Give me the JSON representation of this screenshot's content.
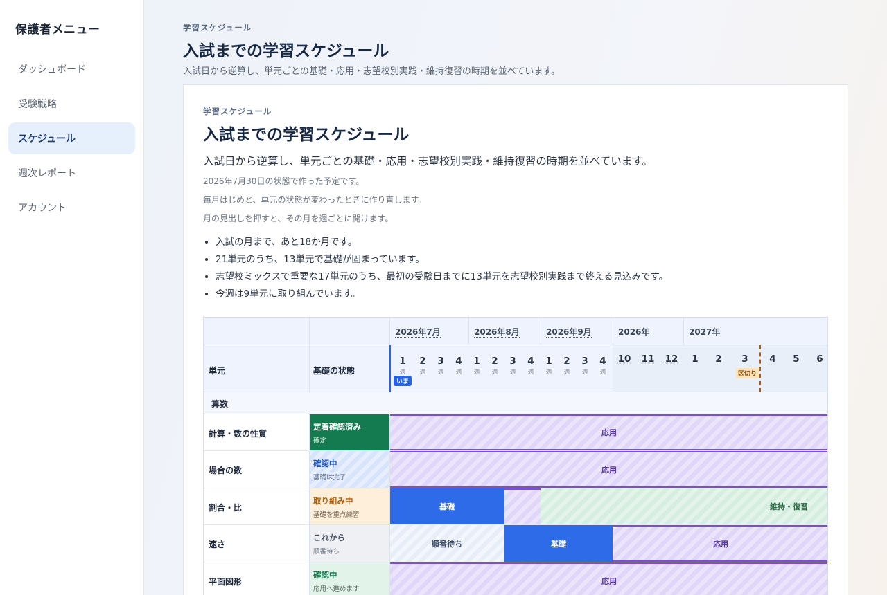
{
  "sidebar": {
    "title": "保護者メニュー",
    "items": [
      {
        "label": "ダッシュボード"
      },
      {
        "label": "受験戦略"
      },
      {
        "label": "スケジュール"
      },
      {
        "label": "週次レポート"
      },
      {
        "label": "アカウント"
      }
    ]
  },
  "page": {
    "eyebrow": "学習スケジュール",
    "title": "入試までの学習スケジュール",
    "description": "入試日から逆算し、単元ごとの基礎・応用・志望校別実践・維持復習の時期を並べています。"
  },
  "card": {
    "eyebrow": "学習スケジュール",
    "title": "入試までの学習スケジュール",
    "lead": "入試日から逆算し、単元ごとの基礎・応用・志望校別実践・維持復習の時期を並べています。",
    "notes": [
      "2026年7月30日の状態で作った予定です。",
      "毎月はじめと、単元の状態が変わったときに作り直します。",
      "月の見出しを押すと、その月を週ごとに開けます。"
    ],
    "bullets": [
      "入試の月まで、あと18か月です。",
      "21単元のうち、13単元で基礎が固まっています。",
      "志望校ミックスで重要な17単元のうち、最初の受験日までに13単元を志望校別実践まで終える見込みです。",
      "今週は9単元に取り組んでいます。"
    ]
  },
  "schedule": {
    "col_unit": "単元",
    "col_status": "基礎の状態",
    "months": [
      "2026年7月",
      "2026年8月",
      "2026年9月",
      "2026年",
      "2027年"
    ],
    "week_suffix": "週",
    "weeks": [
      "1",
      "2",
      "3",
      "4",
      "1",
      "2",
      "3",
      "4",
      "1",
      "2",
      "3",
      "4"
    ],
    "month_cols": [
      "10",
      "11",
      "12",
      "1",
      "2",
      "3",
      "4",
      "5",
      "6"
    ],
    "now_badge": "いま",
    "cutoff_badge": "区切り",
    "section": "算数",
    "rows": [
      {
        "name": "計算・数の性質",
        "status": "定着確認済み",
        "sub": "確定",
        "bars": [
          "応用"
        ]
      },
      {
        "name": "場合の数",
        "status": "確認中",
        "sub": "基礎は完了",
        "bars": [
          "応用"
        ]
      },
      {
        "name": "割合・比",
        "status": "取り組み中",
        "sub": "基礎を重点練習",
        "bars": [
          "基礎",
          "維持・復習"
        ]
      },
      {
        "name": "速さ",
        "status": "これから",
        "sub": "順番待ち",
        "bars": [
          "順番待ち",
          "基礎",
          "応用"
        ]
      },
      {
        "name": "平面図形",
        "status": "確認中",
        "sub": "応用へ進めます",
        "bars": [
          "応用"
        ]
      }
    ]
  }
}
